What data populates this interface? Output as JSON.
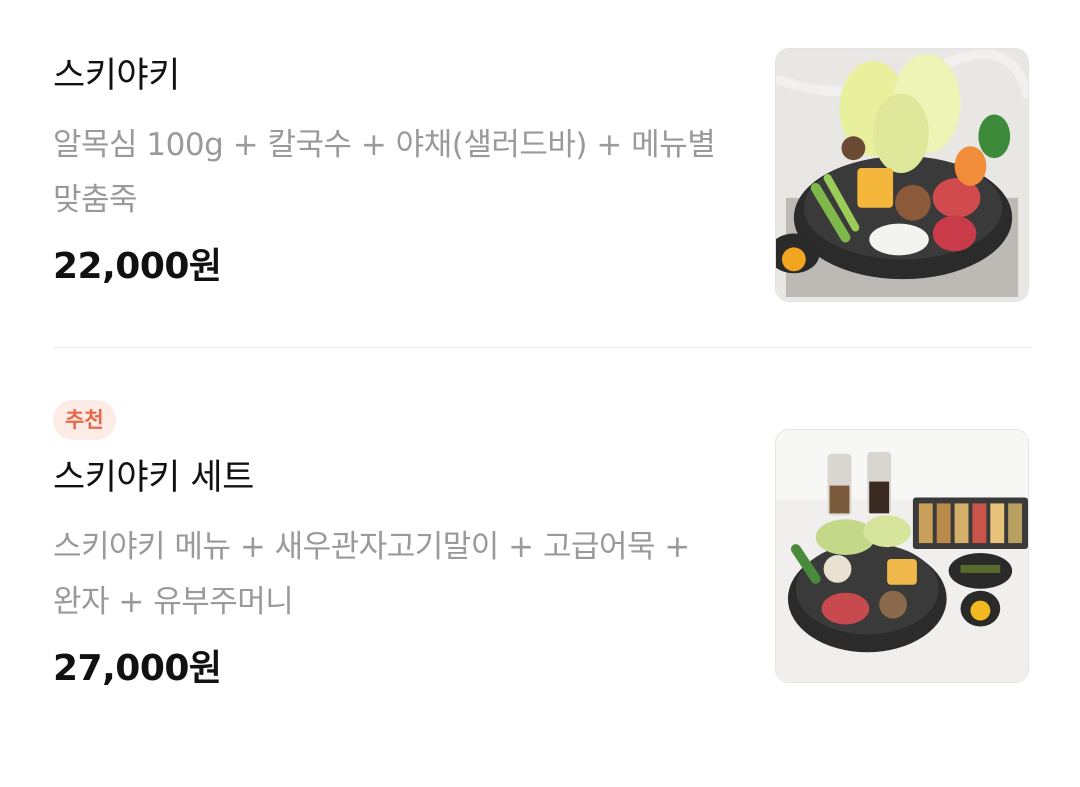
{
  "menu": {
    "items": [
      {
        "badge": "",
        "name": "스키야키",
        "description": "알목심 100g + 칼국수 + 야채(샐러드바) + 메뉴별 맞춤죽",
        "price": "22,000원",
        "image": "sukiyaki-hotpot-photo"
      },
      {
        "badge": "추천",
        "name": "스키야키 세트",
        "description": "스키야키 메뉴 + 새우관자고기말이 + 고급어묵 + 완자 + 유부주머니",
        "price": "27,000원",
        "image": "sukiyaki-set-photo"
      }
    ]
  },
  "colors": {
    "badge_bg": "#fdece6",
    "badge_text": "#e8684a",
    "description": "#9a9a9a",
    "divider": "#ececec"
  }
}
